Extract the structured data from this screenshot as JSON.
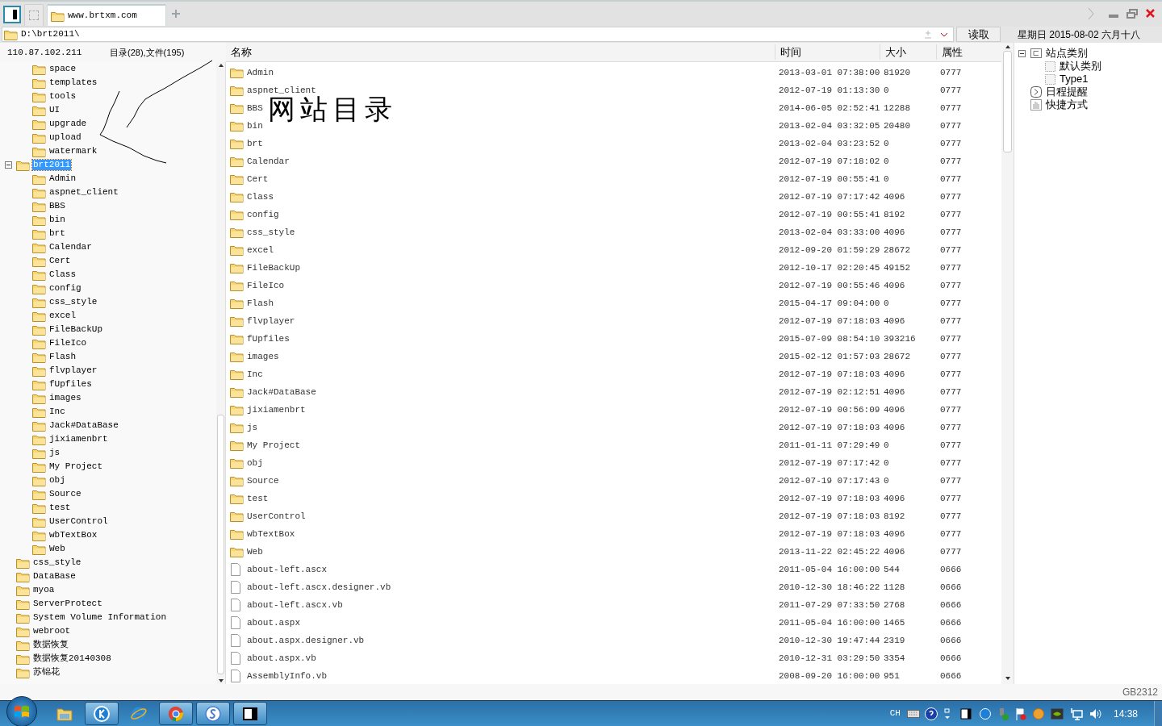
{
  "tabs": [
    {
      "kind": "blank",
      "selected": false
    },
    {
      "kind": "site",
      "label": "www.brtxm.com",
      "selected": true
    }
  ],
  "address": {
    "path": "D:\\brt2011\\",
    "read_button": "读取"
  },
  "calendar_date": "星期日 2015-08-02 六月十八",
  "server_ip": "110.87.102.211",
  "summary": "目录(28),文件(195)",
  "table": {
    "columns": [
      "名称",
      "时间",
      "大小",
      "属性"
    ],
    "rows": [
      {
        "kind": "folder",
        "name": "Admin",
        "time": "2013-03-01 07:38:00",
        "size": "81920",
        "attr": "0777"
      },
      {
        "kind": "folder",
        "name": "aspnet_client",
        "time": "2012-07-19 01:13:30",
        "size": "0",
        "attr": "0777"
      },
      {
        "kind": "folder",
        "name": "BBS",
        "time": "2014-06-05 02:52:41",
        "size": "12288",
        "attr": "0777"
      },
      {
        "kind": "folder",
        "name": "bin",
        "time": "2013-02-04 03:32:05",
        "size": "20480",
        "attr": "0777"
      },
      {
        "kind": "folder",
        "name": "brt",
        "time": "2013-02-04 03:23:52",
        "size": "0",
        "attr": "0777"
      },
      {
        "kind": "folder",
        "name": "Calendar",
        "time": "2012-07-19 07:18:02",
        "size": "0",
        "attr": "0777"
      },
      {
        "kind": "folder",
        "name": "Cert",
        "time": "2012-07-19 00:55:41",
        "size": "0",
        "attr": "0777"
      },
      {
        "kind": "folder",
        "name": "Class",
        "time": "2012-07-19 07:17:42",
        "size": "4096",
        "attr": "0777"
      },
      {
        "kind": "folder",
        "name": "config",
        "time": "2012-07-19 00:55:41",
        "size": "8192",
        "attr": "0777"
      },
      {
        "kind": "folder",
        "name": "css_style",
        "time": "2013-02-04 03:33:00",
        "size": "4096",
        "attr": "0777"
      },
      {
        "kind": "folder",
        "name": "excel",
        "time": "2012-09-20 01:59:29",
        "size": "28672",
        "attr": "0777"
      },
      {
        "kind": "folder",
        "name": "FileBackUp",
        "time": "2012-10-17 02:20:45",
        "size": "49152",
        "attr": "0777"
      },
      {
        "kind": "folder",
        "name": "FileIco",
        "time": "2012-07-19 00:55:46",
        "size": "4096",
        "attr": "0777"
      },
      {
        "kind": "folder",
        "name": "Flash",
        "time": "2015-04-17 09:04:00",
        "size": "0",
        "attr": "0777"
      },
      {
        "kind": "folder",
        "name": "flvplayer",
        "time": "2012-07-19 07:18:03",
        "size": "4096",
        "attr": "0777"
      },
      {
        "kind": "folder",
        "name": "fUpfiles",
        "time": "2015-07-09 08:54:10",
        "size": "393216",
        "attr": "0777"
      },
      {
        "kind": "folder",
        "name": "images",
        "time": "2015-02-12 01:57:03",
        "size": "28672",
        "attr": "0777"
      },
      {
        "kind": "folder",
        "name": "Inc",
        "time": "2012-07-19 07:18:03",
        "size": "4096",
        "attr": "0777"
      },
      {
        "kind": "folder",
        "name": "Jack#DataBase",
        "time": "2012-07-19 02:12:51",
        "size": "4096",
        "attr": "0777"
      },
      {
        "kind": "folder",
        "name": "jixiamenbrt",
        "time": "2012-07-19 00:56:09",
        "size": "4096",
        "attr": "0777"
      },
      {
        "kind": "folder",
        "name": "js",
        "time": "2012-07-19 07:18:03",
        "size": "4096",
        "attr": "0777"
      },
      {
        "kind": "folder",
        "name": "My Project",
        "time": "2011-01-11 07:29:49",
        "size": "0",
        "attr": "0777"
      },
      {
        "kind": "folder",
        "name": "obj",
        "time": "2012-07-19 07:17:42",
        "size": "0",
        "attr": "0777"
      },
      {
        "kind": "folder",
        "name": "Source",
        "time": "2012-07-19 07:17:43",
        "size": "0",
        "attr": "0777"
      },
      {
        "kind": "folder",
        "name": "test",
        "time": "2012-07-19 07:18:03",
        "size": "4096",
        "attr": "0777"
      },
      {
        "kind": "folder",
        "name": "UserControl",
        "time": "2012-07-19 07:18:03",
        "size": "8192",
        "attr": "0777"
      },
      {
        "kind": "folder",
        "name": "wbTextBox",
        "time": "2012-07-19 07:18:03",
        "size": "4096",
        "attr": "0777"
      },
      {
        "kind": "folder",
        "name": "Web",
        "time": "2013-11-22 02:45:22",
        "size": "4096",
        "attr": "0777"
      },
      {
        "kind": "file",
        "name": "about-left.ascx",
        "time": "2011-05-04 16:00:00",
        "size": "544",
        "attr": "0666"
      },
      {
        "kind": "file",
        "name": "about-left.ascx.designer.vb",
        "time": "2010-12-30 18:46:22",
        "size": "1128",
        "attr": "0666"
      },
      {
        "kind": "file",
        "name": "about-left.ascx.vb",
        "time": "2011-07-29 07:33:50",
        "size": "2768",
        "attr": "0666"
      },
      {
        "kind": "file",
        "name": "about.aspx",
        "time": "2011-05-04 16:00:00",
        "size": "1465",
        "attr": "0666"
      },
      {
        "kind": "file",
        "name": "about.aspx.designer.vb",
        "time": "2010-12-30 19:47:44",
        "size": "2319",
        "attr": "0666"
      },
      {
        "kind": "file",
        "name": "about.aspx.vb",
        "time": "2010-12-31 03:29:50",
        "size": "3354",
        "attr": "0666"
      },
      {
        "kind": "file",
        "name": "AssemblyInfo.vb",
        "time": "2008-09-20 16:00:00",
        "size": "951",
        "attr": "0666"
      }
    ]
  },
  "tree": [
    {
      "children": [
        {
          "label": "space",
          "selected": false
        },
        {
          "label": "templates",
          "selected": false
        },
        {
          "label": "tools",
          "selected": false
        },
        {
          "label": "UI",
          "selected": false
        },
        {
          "label": "upgrade",
          "selected": false
        },
        {
          "label": "upload",
          "selected": false
        },
        {
          "label": "watermark",
          "selected": false
        }
      ]
    },
    {
      "label": "brt2011",
      "selected": true,
      "expanded": true,
      "children": [
        {
          "label": "Admin",
          "selected": false
        },
        {
          "label": "aspnet_client",
          "selected": false
        },
        {
          "label": "BBS",
          "selected": false
        },
        {
          "label": "bin",
          "selected": false
        },
        {
          "label": "brt",
          "selected": false
        },
        {
          "label": "Calendar",
          "selected": false
        },
        {
          "label": "Cert",
          "selected": false
        },
        {
          "label": "Class",
          "selected": false
        },
        {
          "label": "config",
          "selected": false
        },
        {
          "label": "css_style",
          "selected": false
        },
        {
          "label": "excel",
          "selected": false
        },
        {
          "label": "FileBackUp",
          "selected": false
        },
        {
          "label": "FileIco",
          "selected": false
        },
        {
          "label": "Flash",
          "selected": false
        },
        {
          "label": "flvplayer",
          "selected": false
        },
        {
          "label": "fUpfiles",
          "selected": false
        },
        {
          "label": "images",
          "selected": false
        },
        {
          "label": "Inc",
          "selected": false
        },
        {
          "label": "Jack#DataBase",
          "selected": false
        },
        {
          "label": "jixiamenbrt",
          "selected": false
        },
        {
          "label": "js",
          "selected": false
        },
        {
          "label": "My Project",
          "selected": false
        },
        {
          "label": "obj",
          "selected": false
        },
        {
          "label": "Source",
          "selected": false
        },
        {
          "label": "test",
          "selected": false
        },
        {
          "label": "UserControl",
          "selected": false
        },
        {
          "label": "wbTextBox",
          "selected": false
        },
        {
          "label": "Web",
          "selected": false
        }
      ]
    },
    {
      "label": "css_style",
      "selected": false
    },
    {
      "label": "DataBase",
      "selected": false
    },
    {
      "label": "myoa",
      "selected": false
    },
    {
      "label": "ServerProtect",
      "selected": false
    },
    {
      "label": "System Volume Information",
      "selected": false
    },
    {
      "label": "webroot",
      "selected": false
    },
    {
      "label": "数据恢复",
      "selected": false
    },
    {
      "label": "数据恢复20140308",
      "selected": false
    },
    {
      "label": "苏锦花",
      "selected": false
    }
  ],
  "site_tree": [
    {
      "kind": "group",
      "label": "站点类别",
      "expanded": true,
      "children": [
        {
          "kind": "category",
          "label": "默认类别"
        },
        {
          "kind": "category",
          "label": "Type1"
        }
      ]
    },
    {
      "kind": "reminder",
      "label": "日程提醒"
    },
    {
      "kind": "shortcut",
      "label": "快捷方式"
    }
  ],
  "annotation": "网站目录",
  "encoding": "GB2312",
  "taskbar": {
    "apps": [
      {
        "kind": "folder",
        "running": false
      },
      {
        "kind": "k",
        "running": true
      },
      {
        "kind": "ie",
        "running": false
      },
      {
        "kind": "chrome",
        "running": true
      },
      {
        "kind": "s",
        "running": true
      },
      {
        "kind": "panel",
        "running": true
      }
    ],
    "language": "CH",
    "clock": "14:38"
  }
}
